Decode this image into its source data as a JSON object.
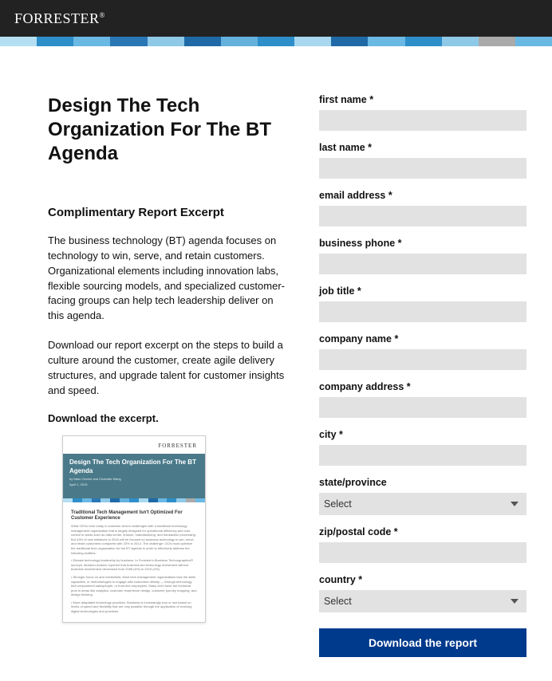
{
  "brand": "FORRESTER",
  "stripe_colors": [
    "#b4dff2",
    "#2d8eca",
    "#6ab8e4",
    "#2a77b5",
    "#8fc9e8",
    "#1f6aa6",
    "#64b1de",
    "#2d8eca",
    "#a8d8ef",
    "#1f6aa6",
    "#6ab8e4",
    "#2d8eca",
    "#8fc9e8",
    "#aaaaaa",
    "#6ab8e4"
  ],
  "page": {
    "title": "Design The Tech Organization For The BT Agenda",
    "subtitle": "Complimentary Report Excerpt",
    "paragraph1": "The business technology (BT) agenda focuses on technology to win, serve, and retain customers. Organizational elements including innovation labs, flexible sourcing models, and specialized customer-facing groups can help tech leadership deliver on this agenda.",
    "paragraph2": "Download our report excerpt on the steps to build a culture around the customer, create agile delivery structures, and upgrade talent for customer insights and speed.",
    "download_prompt": "Download the excerpt."
  },
  "thumb": {
    "brand": "FORRESTER",
    "title": "Design The Tech Organization For The BT Agenda",
    "byline": "by Marc Cecere and Charlotte Wang",
    "date": "April 1, 2015",
    "section": "Traditional Tech Management Isn't Optimized For Customer Experience"
  },
  "form": {
    "first_name": {
      "label": "first name *"
    },
    "last_name": {
      "label": "last name *"
    },
    "email": {
      "label": "email address *"
    },
    "phone": {
      "label": "business phone *"
    },
    "job_title": {
      "label": "job title *"
    },
    "company_name": {
      "label": "company name *"
    },
    "company_address": {
      "label": "company address *"
    },
    "city": {
      "label": "city *"
    },
    "state": {
      "label": "state/province",
      "selected": "Select"
    },
    "zip": {
      "label": "zip/postal code *"
    },
    "country": {
      "label": "country *",
      "selected": "Select"
    },
    "submit": "Download the report"
  }
}
